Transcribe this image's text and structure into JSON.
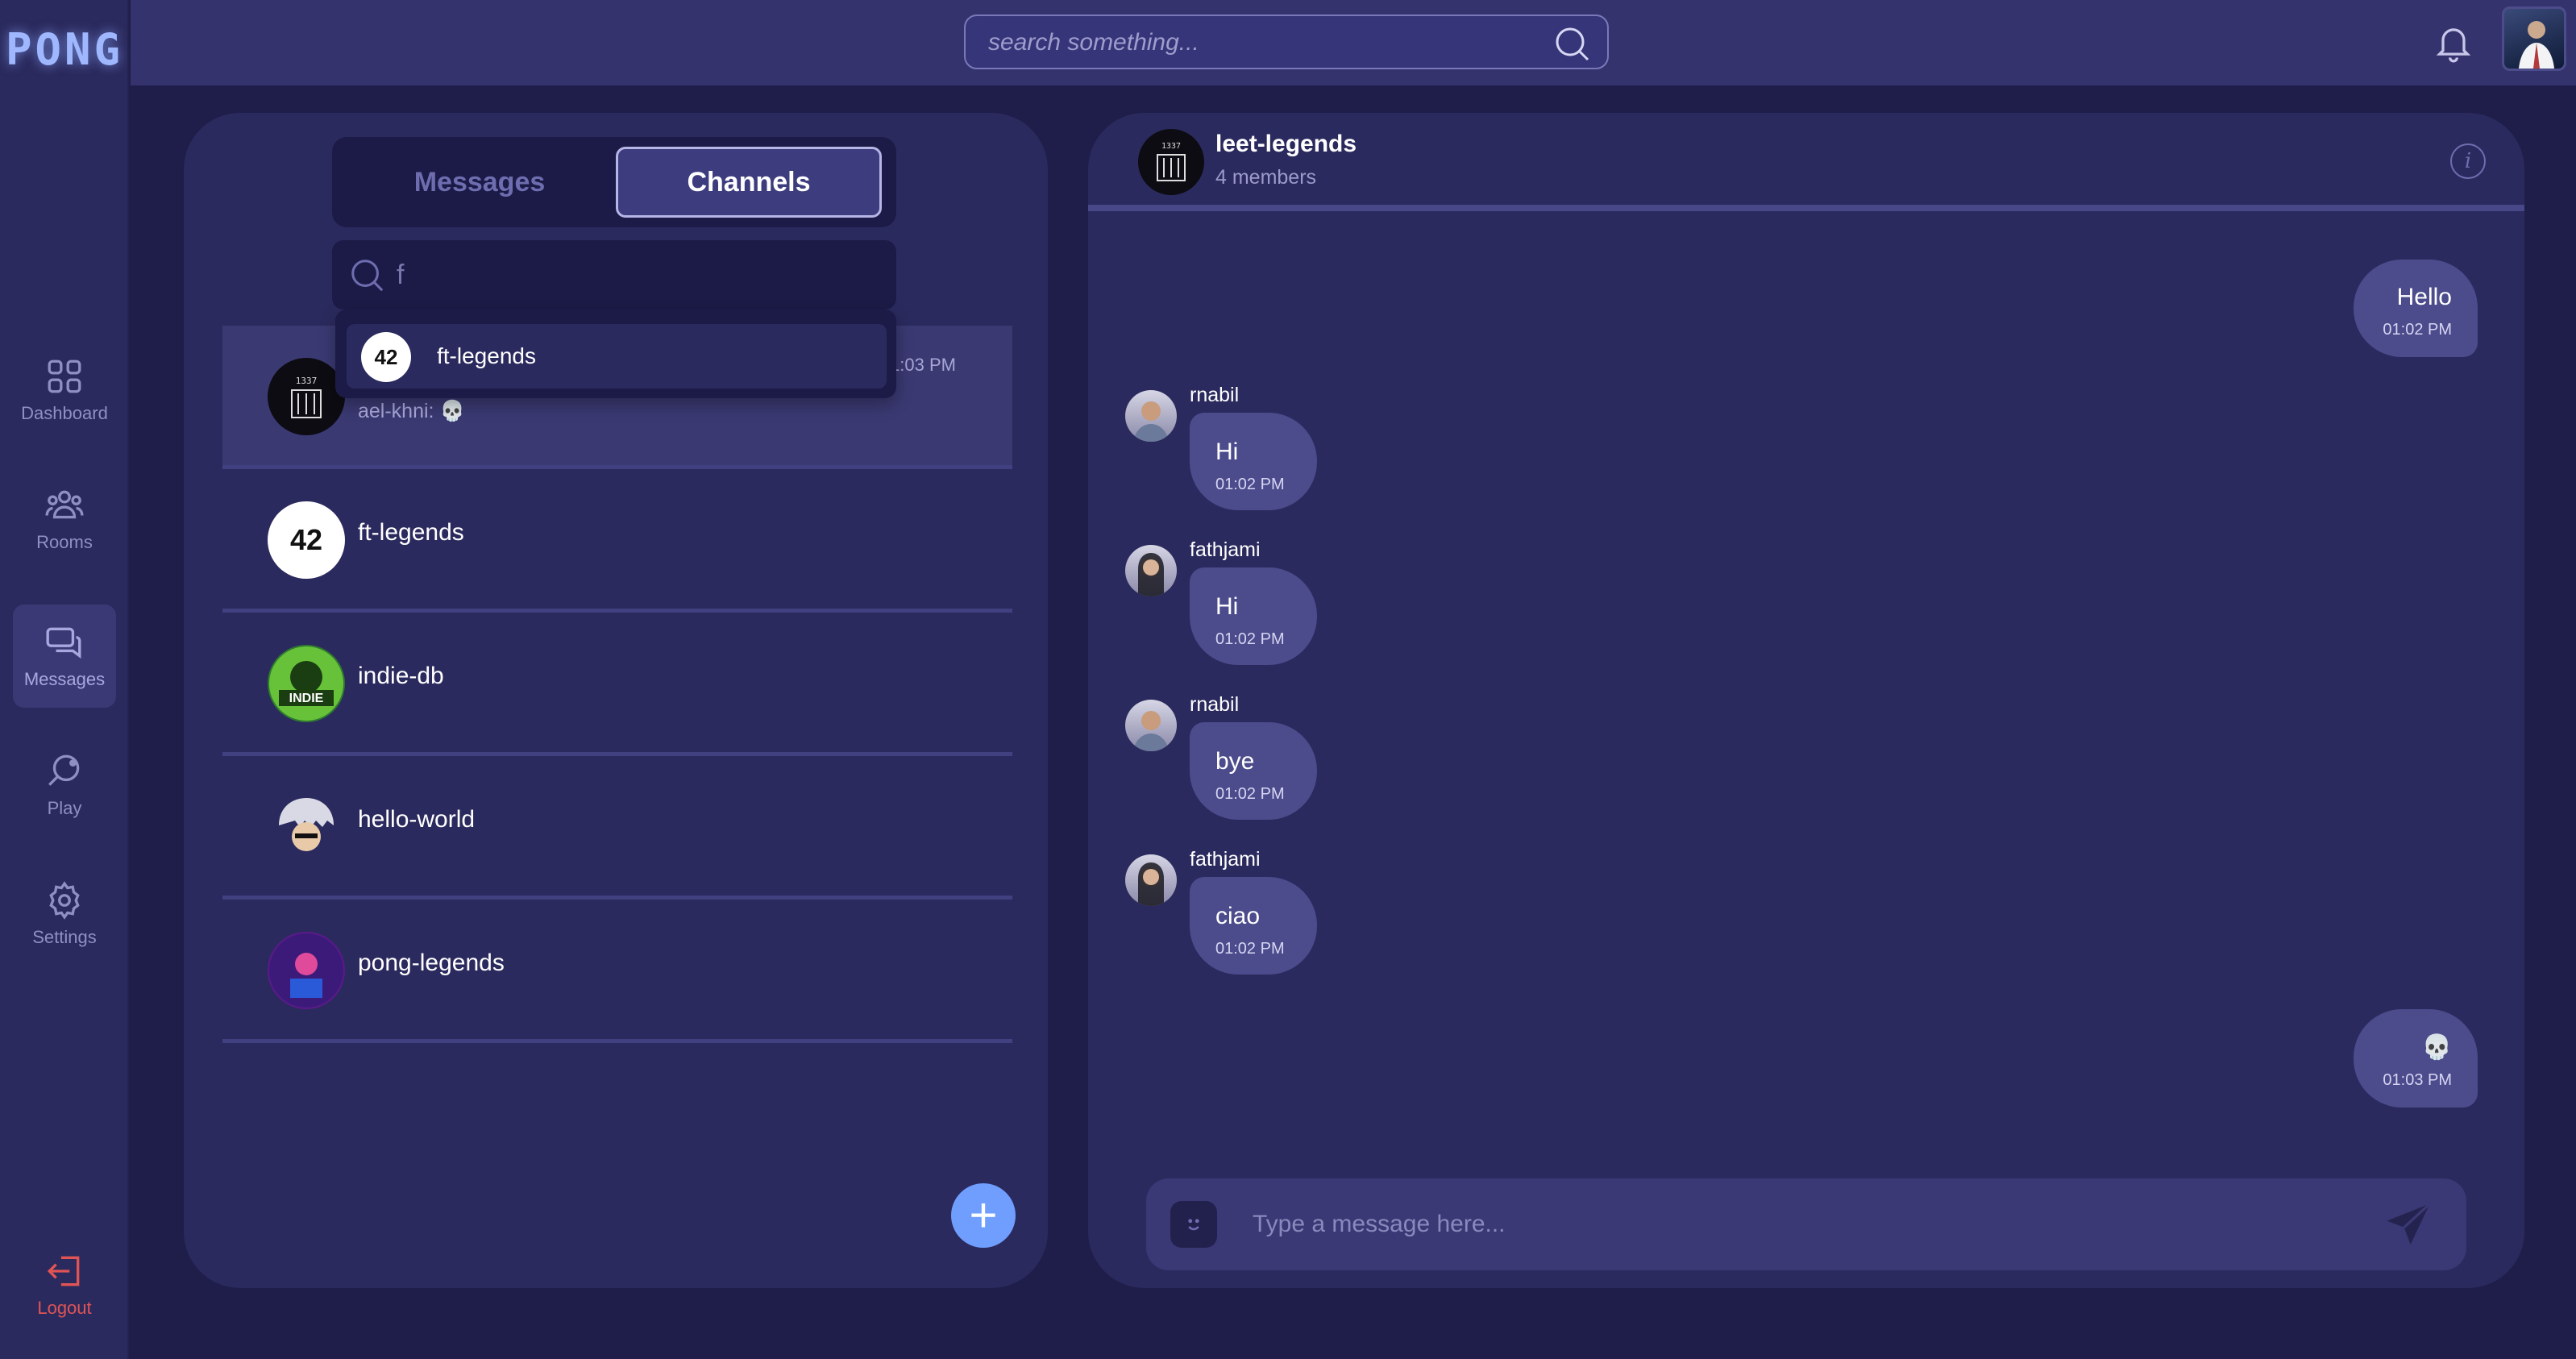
{
  "app": {
    "logo": "PONG"
  },
  "nav": {
    "items": [
      {
        "label": "Dashboard",
        "icon": "grid-icon"
      },
      {
        "label": "Rooms",
        "icon": "users-icon"
      },
      {
        "label": "Messages",
        "icon": "chat-icon",
        "active": true
      },
      {
        "label": "Play",
        "icon": "play-icon"
      },
      {
        "label": "Settings",
        "icon": "gear-icon"
      }
    ],
    "logout": "Logout"
  },
  "topbar": {
    "search_placeholder": "search something..."
  },
  "tabs": {
    "messages": "Messages",
    "channels": "Channels",
    "active": "Channels"
  },
  "channel_search": {
    "value": "f"
  },
  "dropdown": {
    "items": [
      {
        "label": "ft-legends"
      }
    ]
  },
  "channels": [
    {
      "name": "leet-legends",
      "preview": "ael-khni: 💀",
      "time": "01:03 PM",
      "selected": true
    },
    {
      "name": "ft-legends"
    },
    {
      "name": "indie-db"
    },
    {
      "name": "hello-world"
    },
    {
      "name": "pong-legends"
    }
  ],
  "chat": {
    "title": "leet-legends",
    "members": "4 members",
    "messages": [
      {
        "dir": "out",
        "text": "Hello",
        "time": "01:02 PM"
      },
      {
        "dir": "in",
        "user": "rnabil",
        "text": "Hi",
        "time": "01:02 PM"
      },
      {
        "dir": "in",
        "user": "fathjami",
        "text": "Hi",
        "time": "01:02 PM"
      },
      {
        "dir": "in",
        "user": "rnabil",
        "text": "bye",
        "time": "01:02 PM"
      },
      {
        "dir": "in",
        "user": "fathjami",
        "text": "ciao",
        "time": "01:02 PM"
      },
      {
        "dir": "out",
        "text": "💀",
        "time": "01:03 PM"
      }
    ],
    "composer_placeholder": "Type a message here..."
  },
  "colors": {
    "accent": "#6f9eff",
    "panel": "#2b2a5e",
    "bubble": "#4c4b8c",
    "logout": "#e05454"
  }
}
